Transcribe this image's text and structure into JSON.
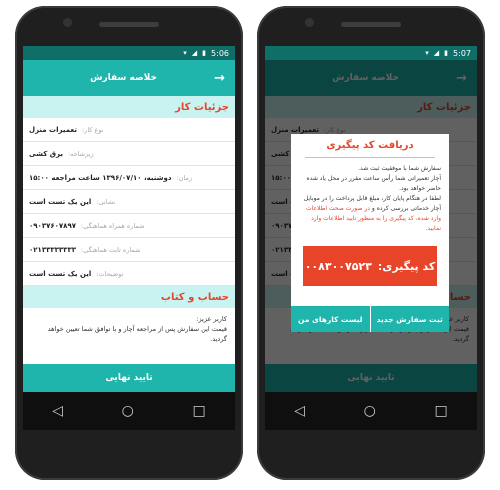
{
  "status": {
    "left_time": "5:06",
    "right_time": "5:07"
  },
  "header": {
    "title": "خلاصه سفارش",
    "back_arrow": "→"
  },
  "details": {
    "heading": "جزئیات کار",
    "rows": [
      {
        "label": "نوع کار:",
        "value": "تعمیرات منزل"
      },
      {
        "label": "زیرشاخه:",
        "value": "برق کشی"
      },
      {
        "label": "زمان:",
        "value": "دوشنبه، ۱۳۹۶/۰۷/۱۰ ساعت مراجعه ۱۵:۰۰"
      },
      {
        "label": "نشانی:",
        "value": "این یک تست است"
      },
      {
        "label": "شماره همراه هماهنگی:",
        "value": "۰۹۰۳۷۶۰۷۸۹۷"
      },
      {
        "label": "شماره ثابت هماهنگی:",
        "value": "۰۲۱۳۳۳۳۳۳۳۳"
      },
      {
        "label": "توضیحات:",
        "value": "این یک تست است"
      }
    ]
  },
  "account": {
    "heading": "حساب و کتاب",
    "note_title": "کاربر عزیز:",
    "note_text": "قیمت این سفارش پس از مراجعه آچار و با توافق شما تعیین خواهد گردید."
  },
  "confirm_label": "تایید نهایی",
  "dialog": {
    "title": "دریافت کد پیگیری",
    "line1": "سفارش شما با موفقیت ثبت شد.",
    "line2": "آچار تعمیراتی شما رأس ساعت مقرر در محل یاد شده حاضر خواهد بود.",
    "line3": "لطفا در هنگام پایان کار، مبلغ قابل پرداخت را در موبایل آچار خدماتی بررسی کرده و",
    "line3_warn": "در صورت صحت اطلاعات وارد شده، کد پیگیری را به منظور تایید اطلاعات وارد نمایید.",
    "tracking_label": "کد پیگیری:",
    "tracking_code": "۰۰۸۳۰۰۷۵۲۳",
    "btn_orders": "لیست کارهای من",
    "btn_new": "ثبت سفارش جدید"
  },
  "nav": {
    "back": "◁",
    "home": "○",
    "recent": "□"
  },
  "colors": {
    "teal": "#1fb5ac",
    "dark_teal": "#0e6e68",
    "accent": "#e8442a",
    "light_teal": "#c9f3f0"
  }
}
